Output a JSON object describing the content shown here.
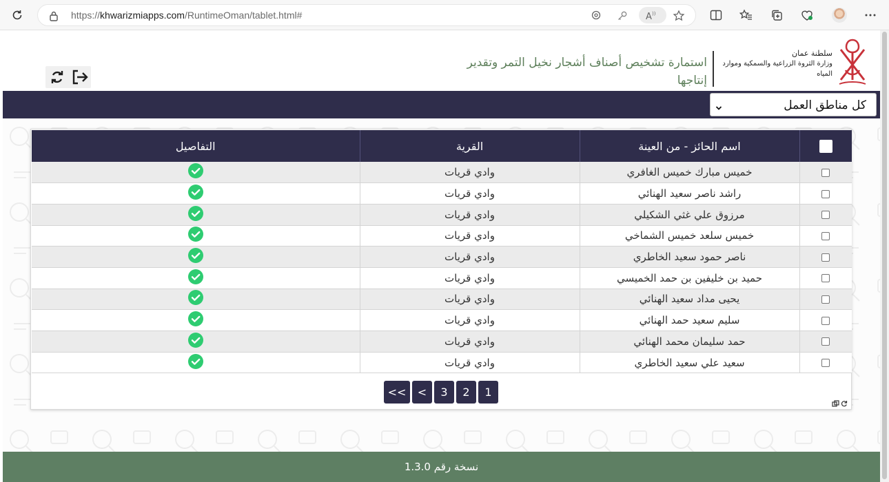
{
  "browser": {
    "url_prefix": "https://",
    "url_domain": "khwarizmiapps.com",
    "url_path": "/RuntimeOman/tablet.html#"
  },
  "header": {
    "ministry_line1": "سلطنة عمان",
    "ministry_line2": "وزارة الثروة الزراعية والسمكية وموارد المياه",
    "form_title": "استمارة تشخيص أصناف أشجار نخيل التمر وتقدير إنتاجها"
  },
  "filter": {
    "zone_value": "كل مناطق العمل"
  },
  "table": {
    "headers": {
      "name": "اسم الحائز - من العينة",
      "village": "القرية",
      "details": "التفاصيل"
    },
    "rows": [
      {
        "name": "خميس مبارك خميس الغافري",
        "village": "وادي قريات"
      },
      {
        "name": "راشد ناصر سعيد الهنائي",
        "village": "وادي قريات"
      },
      {
        "name": "مرزوق علي غثي الشكيلي",
        "village": "وادي قريات"
      },
      {
        "name": "خميس سلعد خميس الشماخي",
        "village": "وادي قريات"
      },
      {
        "name": "ناصر حمود سعيد الخاطري",
        "village": "وادي قريات"
      },
      {
        "name": "حميد بن خليفين بن حمد الخميسي",
        "village": "وادي قريات"
      },
      {
        "name": "يحيى مداد سعيد الهنائي",
        "village": "وادي قريات"
      },
      {
        "name": "سليم سعيد حمد الهنائي",
        "village": "وادي قريات"
      },
      {
        "name": "حمد سليمان محمد الهنائي",
        "village": "وادي قريات"
      },
      {
        "name": "سعيد علي سعيد الخاطري",
        "village": "وادي قريات"
      }
    ]
  },
  "pagination": {
    "first": "<<",
    "prev": "<",
    "pages": [
      "3",
      "2",
      "1"
    ]
  },
  "footer": {
    "version_text": "نسخة رقم 1.3.0"
  },
  "colors": {
    "navbar": "#2f2d4b",
    "footer": "#5e7f63",
    "title_green": "#5d7f5a",
    "check_green": "#2ecc71"
  }
}
